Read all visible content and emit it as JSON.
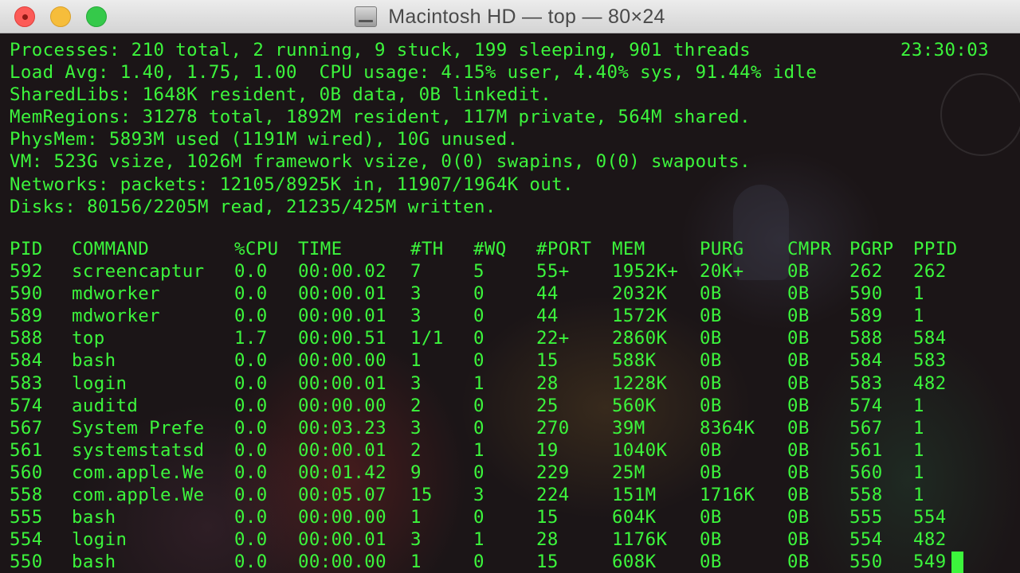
{
  "window": {
    "title": "Macintosh HD — top — 80×24"
  },
  "summary": {
    "lines": [
      "Processes: 210 total, 2 running, 9 stuck, 199 sleeping, 901 threads",
      "Load Avg: 1.40, 1.75, 1.00  CPU usage: 4.15% user, 4.40% sys, 91.44% idle",
      "SharedLibs: 1648K resident, 0B data, 0B linkedit.",
      "MemRegions: 31278 total, 1892M resident, 117M private, 564M shared.",
      "PhysMem: 5893M used (1191M wired), 10G unused.",
      "VM: 523G vsize, 1026M framework vsize, 0(0) swapins, 0(0) swapouts.",
      "Networks: packets: 12105/8925K in, 11907/1964K out.",
      "Disks: 80156/2205M read, 21235/425M written."
    ],
    "clock": "23:30:03"
  },
  "table": {
    "headers": [
      "PID",
      "COMMAND",
      "%CPU",
      "TIME",
      "#TH",
      "#WQ",
      "#PORT",
      "MEM",
      "PURG",
      "CMPR",
      "PGRP",
      "PPID"
    ],
    "rows": [
      [
        "592",
        "screencaptur",
        "0.0",
        "00:00.02",
        "7",
        "5",
        "55+",
        "1952K+",
        "20K+",
        "0B",
        "262",
        "262"
      ],
      [
        "590",
        "mdworker",
        "0.0",
        "00:00.01",
        "3",
        "0",
        "44",
        "2032K",
        "0B",
        "0B",
        "590",
        "1"
      ],
      [
        "589",
        "mdworker",
        "0.0",
        "00:00.01",
        "3",
        "0",
        "44",
        "1572K",
        "0B",
        "0B",
        "589",
        "1"
      ],
      [
        "588",
        "top",
        "1.7",
        "00:00.51",
        "1/1",
        "0",
        "22+",
        "2860K",
        "0B",
        "0B",
        "588",
        "584"
      ],
      [
        "584",
        "bash",
        "0.0",
        "00:00.00",
        "1",
        "0",
        "15",
        "588K",
        "0B",
        "0B",
        "584",
        "583"
      ],
      [
        "583",
        "login",
        "0.0",
        "00:00.01",
        "3",
        "1",
        "28",
        "1228K",
        "0B",
        "0B",
        "583",
        "482"
      ],
      [
        "574",
        "auditd",
        "0.0",
        "00:00.00",
        "2",
        "0",
        "25",
        "560K",
        "0B",
        "0B",
        "574",
        "1"
      ],
      [
        "567",
        "System Prefe",
        "0.0",
        "00:03.23",
        "3",
        "0",
        "270",
        "39M",
        "8364K",
        "0B",
        "567",
        "1"
      ],
      [
        "561",
        "systemstatsd",
        "0.0",
        "00:00.01",
        "2",
        "1",
        "19",
        "1040K",
        "0B",
        "0B",
        "561",
        "1"
      ],
      [
        "560",
        "com.apple.We",
        "0.0",
        "00:01.42",
        "9",
        "0",
        "229",
        "25M",
        "0B",
        "0B",
        "560",
        "1"
      ],
      [
        "558",
        "com.apple.We",
        "0.0",
        "00:05.07",
        "15",
        "3",
        "224",
        "151M",
        "1716K",
        "0B",
        "558",
        "1"
      ],
      [
        "555",
        "bash",
        "0.0",
        "00:00.00",
        "1",
        "0",
        "15",
        "604K",
        "0B",
        "0B",
        "555",
        "554"
      ],
      [
        "554",
        "login",
        "0.0",
        "00:00.01",
        "3",
        "1",
        "28",
        "1176K",
        "0B",
        "0B",
        "554",
        "482"
      ],
      [
        "550",
        "bash",
        "0.0",
        "00:00.00",
        "1",
        "0",
        "15",
        "608K",
        "0B",
        "0B",
        "550",
        "549"
      ]
    ]
  },
  "colors": {
    "terminal_text": "#3cf53c",
    "close": "#fc5b57",
    "minimize": "#f6bd3b",
    "zoom": "#35c94a"
  }
}
